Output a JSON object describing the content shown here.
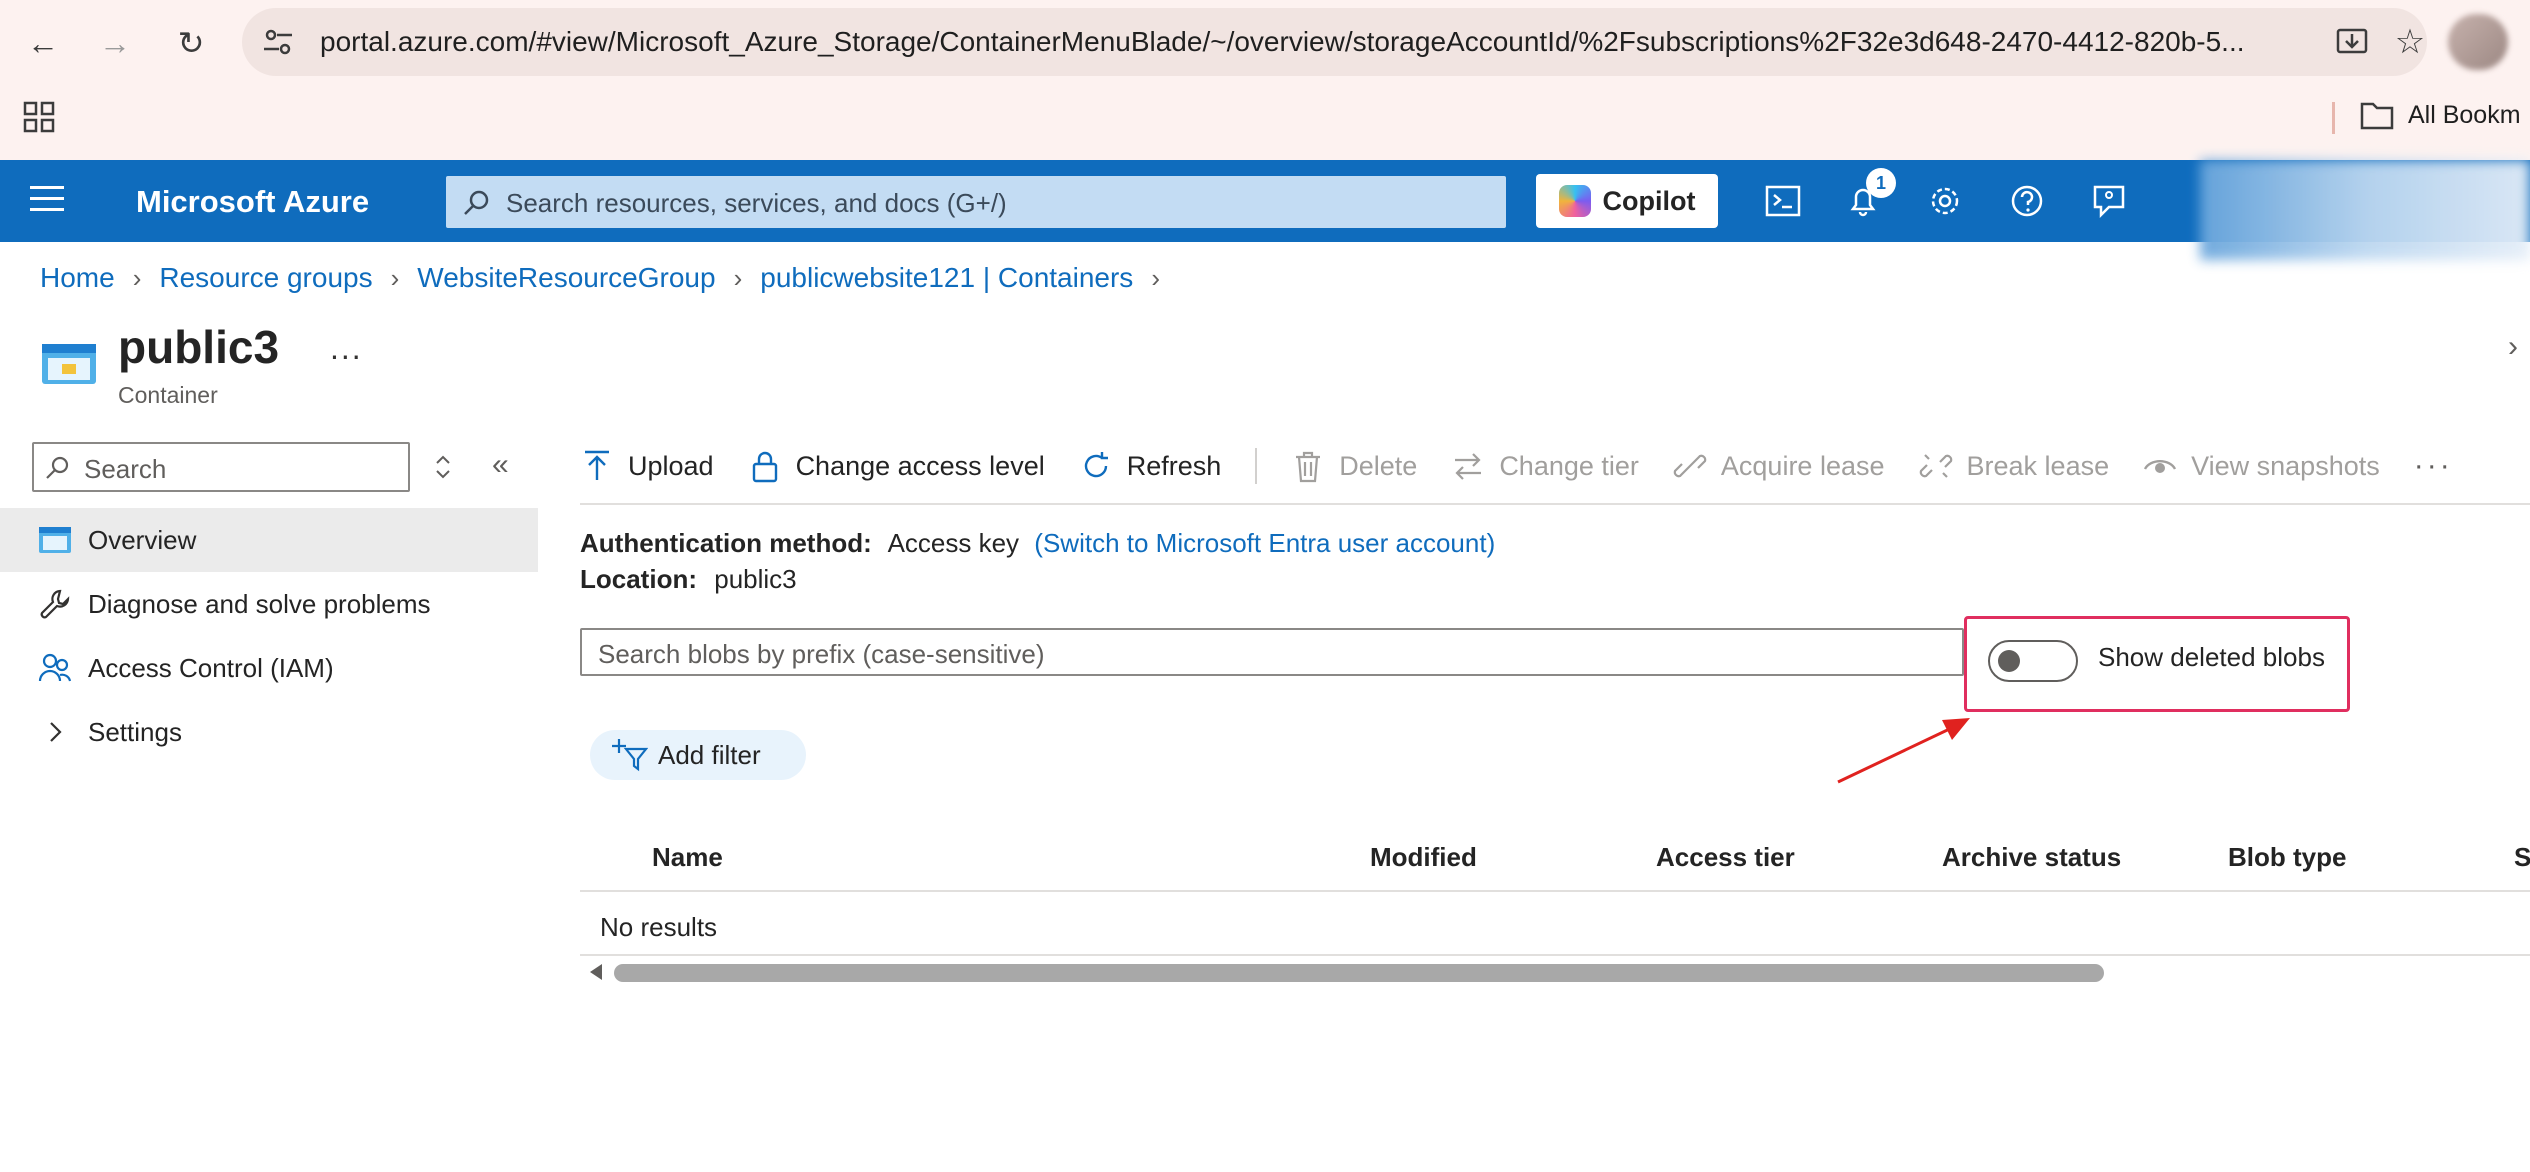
{
  "browser": {
    "url": "portal.azure.com/#view/Microsoft_Azure_Storage/ContainerMenuBlade/~/overview/storageAccountId/%2Fsubscriptions%2F32e3d648-2470-4412-820b-5...",
    "bookmarks_label": "All Bookm"
  },
  "azure_header": {
    "brand": "Microsoft Azure",
    "search_placeholder": "Search resources, services, and docs (G+/)",
    "copilot_label": "Copilot",
    "notification_count": "1"
  },
  "breadcrumb": {
    "items": [
      "Home",
      "Resource groups",
      "WebsiteResourceGroup",
      "publicwebsite121 | Containers"
    ]
  },
  "page": {
    "title": "public3",
    "subtitle": "Container",
    "more": "..."
  },
  "sidebar": {
    "search_placeholder": "Search",
    "items": [
      {
        "label": "Overview",
        "icon": "container-icon",
        "active": true
      },
      {
        "label": "Diagnose and solve problems",
        "icon": "wrench-icon"
      },
      {
        "label": "Access Control (IAM)",
        "icon": "people-icon"
      },
      {
        "label": "Settings",
        "icon": "chevron-right-icon"
      }
    ]
  },
  "toolbar": {
    "upload": "Upload",
    "change_access_level": "Change access level",
    "refresh": "Refresh",
    "delete": "Delete",
    "change_tier": "Change tier",
    "acquire_lease": "Acquire lease",
    "break_lease": "Break lease",
    "view_snapshots": "View snapshots",
    "more": "···"
  },
  "info": {
    "auth_label": "Authentication method:",
    "auth_value": "Access key",
    "auth_link": "(Switch to Microsoft Entra user account)",
    "location_label": "Location:",
    "location_value": "public3"
  },
  "blobs": {
    "search_placeholder": "Search blobs by prefix (case-sensitive)",
    "show_deleted_label": "Show deleted blobs",
    "show_deleted_on": false,
    "add_filter": "Add filter",
    "columns": [
      "Name",
      "Modified",
      "Access tier",
      "Archive status",
      "Blob type",
      "S"
    ],
    "empty_text": "No results"
  },
  "colors": {
    "azure_blue": "#0f6cbd",
    "highlight": "#e02e5f"
  }
}
